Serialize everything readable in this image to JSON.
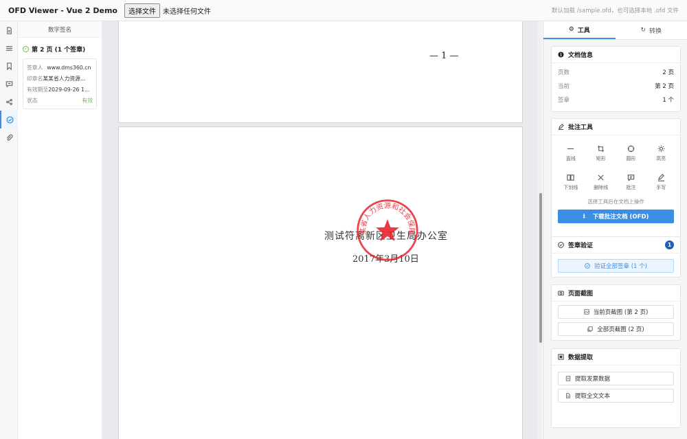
{
  "topbar": {
    "title": "OFD Viewer - Vue 2 Demo",
    "choose_file_label": "选择文件",
    "file_status": "未选择任何文件",
    "hint": "默认加载 /sample.ofd，也可选择本地 .ofd 文件"
  },
  "rail": {
    "items": [
      "pages-icon",
      "settings-sliders-icon",
      "bookmark-icon",
      "comment-icon",
      "share-icon",
      "signature-check-icon",
      "attachment-icon"
    ],
    "active_index": 5
  },
  "signature_panel": {
    "title": "数字签名",
    "page_group": "第 2 页 (1 个签章)",
    "card": {
      "signer_key": "签章人",
      "signer_val": "www.dms360.cn",
      "seal_key": "印章名",
      "seal_val": "某某省人力资源...",
      "valid_key": "有效期至",
      "valid_val": "2029-09-26 1...",
      "status_key": "状态",
      "status_val": "有效"
    }
  },
  "document": {
    "page1_number": "— 1 —",
    "line1": "测试符离新区卫生局办公室",
    "line2": "2017年3月10日",
    "seal_text": "某某省人力资源和社会保障厅",
    "seal_color": "#e8232d"
  },
  "right_panel": {
    "tabs": [
      {
        "label": "工具",
        "icon": "gear-icon"
      },
      {
        "label": "转换",
        "icon": "refresh-icon"
      }
    ],
    "doc_info": {
      "title": "文档信息",
      "rows": [
        {
          "key": "页数",
          "value": "2 页"
        },
        {
          "key": "当前",
          "value": "第 2 页"
        },
        {
          "key": "签章",
          "value": "1 个"
        }
      ]
    },
    "annotation": {
      "title": "批注工具",
      "tools": [
        {
          "label": "直线",
          "icon": "line-icon"
        },
        {
          "label": "矩形",
          "icon": "crop-rect-icon"
        },
        {
          "label": "圆形",
          "icon": "circle-icon"
        },
        {
          "label": "高亮",
          "icon": "highlight-sun-icon"
        },
        {
          "label": "下划线",
          "icon": "underline-book-icon"
        },
        {
          "label": "删除线",
          "icon": "strike-x-icon"
        },
        {
          "label": "批注",
          "icon": "note-icon"
        },
        {
          "label": "手写",
          "icon": "pen-icon"
        }
      ],
      "hint": "选择工具后在文档上操作",
      "download_label": "下载批注文档 (OFD)"
    },
    "verify": {
      "title": "签章验证",
      "badge": "1",
      "button": "验证全部签章 (1 个)"
    },
    "screenshot": {
      "title": "页面截图",
      "current": "当前页截图 (第 2 页)",
      "all": "全部页截图 (2 页)"
    },
    "extract": {
      "title": "数据提取",
      "invoice": "提取发票数据",
      "fulltext": "提取全文文本"
    },
    "accent_color": "#3a8ee6"
  }
}
